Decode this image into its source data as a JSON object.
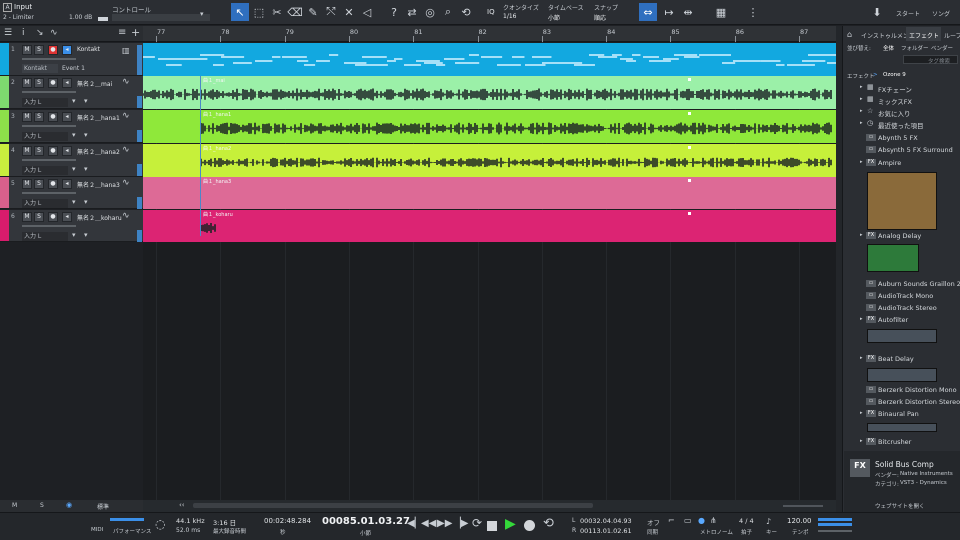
{
  "toolbar": {
    "track_title": "Input",
    "insert_name": "2 - Limiter",
    "gain_value": "1.00 dB",
    "control_label": "コントロール",
    "quantize_label": "クオンタイズ",
    "quantize_value": "1/16",
    "timebase_label": "タイムベース",
    "timebase_value": "小節",
    "snap_label": "スナップ",
    "snap_value": "順応",
    "iq_label": "IQ",
    "start_label": "スタート",
    "song_label": "ソング"
  },
  "ruler": {
    "bars": [
      "77",
      "78",
      "79",
      "80",
      "81",
      "82",
      "83",
      "84",
      "85",
      "86",
      "87"
    ]
  },
  "tracks": [
    {
      "num": "1",
      "name": "Kontakt",
      "sub": "Kontakt",
      "sub2": "Event 1",
      "color": "#12a8e0",
      "lane": "#12a8e0"
    },
    {
      "num": "2",
      "name": "無名２＿mai",
      "input": "入力 L",
      "color": "#7ed96f",
      "lane": "#9bf0a8",
      "clip": "曲１_mai"
    },
    {
      "num": "3",
      "name": "無名２＿hana1",
      "input": "入力 L",
      "color": "#8de04a",
      "lane": "#8fe83a",
      "clip": "曲１_hana1"
    },
    {
      "num": "4",
      "name": "無名２＿hana2",
      "input": "入力 L",
      "color": "#c8ee3e",
      "lane": "#c6f03a",
      "clip": "曲１_hana2"
    },
    {
      "num": "5",
      "name": "無名２＿hana3",
      "input": "入力 L",
      "color": "#d8608c",
      "lane": "#dd6a96",
      "clip": "曲１_hana3"
    },
    {
      "num": "6",
      "name": "無名２＿koharu",
      "input": "入力 L",
      "color": "#d81c6c",
      "lane": "#dc2473",
      "clip": "曲１_koharu"
    }
  ],
  "bottom_left": {
    "m": "M",
    "s": "S",
    "mode": "標準"
  },
  "browser": {
    "tabs": [
      "インストゥルメント",
      "エフェクト",
      "ループ"
    ],
    "sort_label": "並び替え:",
    "sort_tabs": [
      "全体",
      "フォルダー",
      "ベンダー"
    ],
    "tag_search": "タグ検索",
    "path": [
      "エフェクト",
      ">",
      "Ozone 9"
    ],
    "folders": [
      "FXチェーン",
      "ミックスFX",
      "お気に入り",
      "最近使った項目"
    ],
    "items": [
      "Abynth 5 FX",
      "Absynth 5 FX Surround",
      "Ampire",
      "Analog Delay",
      "Auburn Sounds Graillon 2-Fr",
      "AudioTrack Mono",
      "AudioTrack Stereo",
      "Autofilter",
      "Beat Delay",
      "Berzerk Distortion Mono",
      "Berzerk Distortion Stereo",
      "Binaural Pan",
      "Bitcrusher"
    ],
    "info": {
      "badge": "FX",
      "title": "Solid Bus Comp",
      "vendor_label": "ベンダー:",
      "vendor": "Native Instruments",
      "category_label": "カテゴリ:",
      "category": "VST3 - Dynamics",
      "web": "ウェブサイトを開く"
    }
  },
  "transport": {
    "midi": "MIDI",
    "performance": "パフォーマンス",
    "sample_rate": "44.1 kHz",
    "latency": "52.0 ms",
    "record_days": "3:16 日",
    "record_label": "最大録音時間",
    "time": "00:02:48.284",
    "time_unit": "秒",
    "position": "00085.01.03.27",
    "position_unit": "小節",
    "loop_l": "00032.04.04.93",
    "loop_r": "00113.01.02.61",
    "loop_l_label": "L",
    "loop_r_label": "R",
    "off": "オフ",
    "sync": "同期",
    "metronome": "メトロノーム",
    "signature": "4 / 4",
    "signature_label": "拍子",
    "key_label": "キー",
    "tempo": "120.00",
    "tempo_label": "テンポ"
  }
}
